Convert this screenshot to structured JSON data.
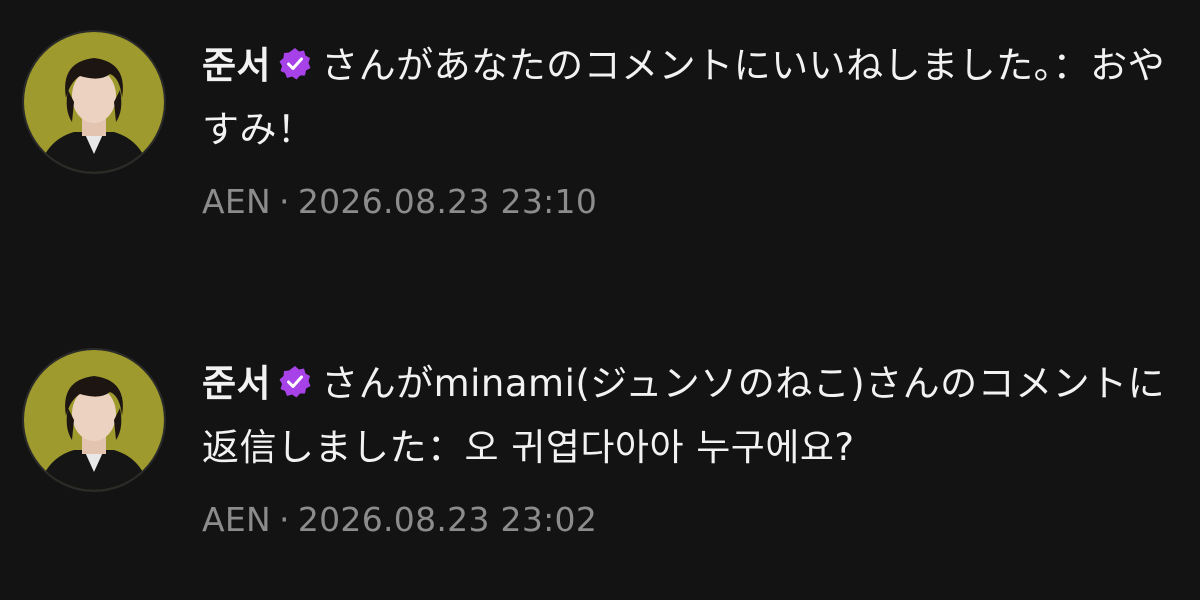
{
  "colors": {
    "background": "#131313",
    "text": "#f2f2f2",
    "meta_text": "#8c8c8c",
    "verified_badge": "#a742e8",
    "avatar_background": "#9e9a2e"
  },
  "notifications": [
    {
      "avatar_icon": "user-avatar-photo",
      "username": "준서",
      "verified_icon": "verified-badge-icon",
      "message": "さんがあなたのコメントにいいねしました。：おやすみ！",
      "app": "AEN",
      "separator": "·",
      "timestamp": "2026.08.23 23:10"
    },
    {
      "avatar_icon": "user-avatar-photo",
      "username": "준서",
      "verified_icon": "verified-badge-icon",
      "message": "さんがminami(ジュンソのねこ)さんのコメントに返信しました：오 귀엽다아아 누구에요?",
      "app": "AEN",
      "separator": "·",
      "timestamp": "2026.08.23 23:02"
    }
  ]
}
